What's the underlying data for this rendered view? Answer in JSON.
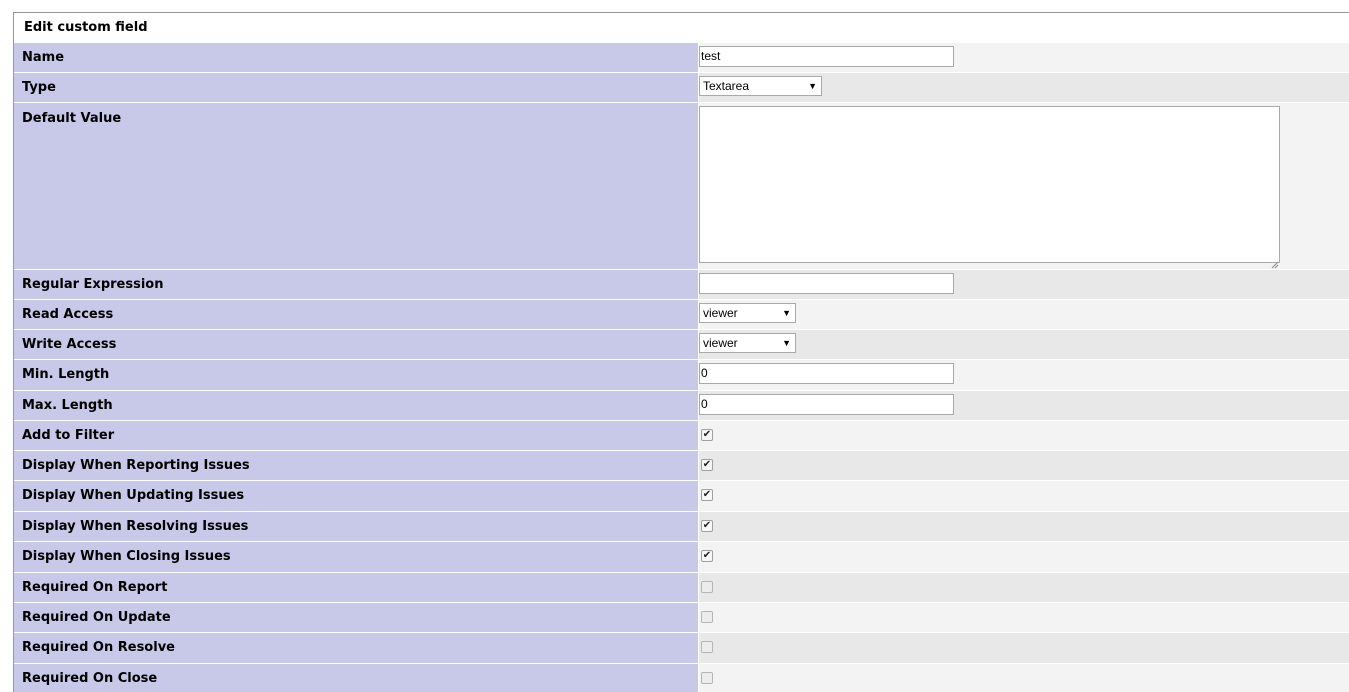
{
  "form": {
    "title": "Edit custom field"
  },
  "fields": {
    "name": {
      "label": "Name",
      "value": "test"
    },
    "type": {
      "label": "Type",
      "value": "Textarea"
    },
    "default_value": {
      "label": "Default Value",
      "value": ""
    },
    "regex": {
      "label": "Regular Expression",
      "value": ""
    },
    "read_access": {
      "label": "Read Access",
      "value": "viewer"
    },
    "write_access": {
      "label": "Write Access",
      "value": "viewer"
    },
    "min_length": {
      "label": "Min. Length",
      "value": "0"
    },
    "max_length": {
      "label": "Max. Length",
      "value": "0"
    },
    "add_to_filter": {
      "label": "Add to Filter",
      "checked": true
    },
    "display_reporting": {
      "label": "Display When Reporting Issues",
      "checked": true
    },
    "display_updating": {
      "label": "Display When Updating Issues",
      "checked": true
    },
    "display_resolving": {
      "label": "Display When Resolving Issues",
      "checked": true
    },
    "display_closing": {
      "label": "Display When Closing Issues",
      "checked": true
    },
    "required_report": {
      "label": "Required On Report",
      "checked": false
    },
    "required_update": {
      "label": "Required On Update",
      "checked": false
    },
    "required_resolve": {
      "label": "Required On Resolve",
      "checked": false
    },
    "required_close": {
      "label": "Required On Close",
      "checked": false
    }
  },
  "icons": {
    "dropdown": "triangle-down-icon",
    "check": "checkmark-icon"
  },
  "colors": {
    "label_bg": "#c8c8e8",
    "row_light": "#f3f3f3",
    "row_dark": "#e8e8e8"
  }
}
